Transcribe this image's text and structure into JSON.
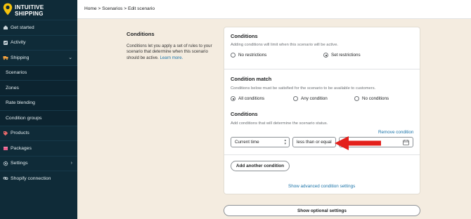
{
  "brand": {
    "line1": "INTUITIVE",
    "line2": "SHIPPING"
  },
  "sidebar": {
    "items": [
      {
        "label": "Get started",
        "icon": "home-icon"
      },
      {
        "label": "Activity",
        "icon": "activity-icon"
      },
      {
        "label": "Shipping",
        "icon": "truck-icon",
        "expanded": true
      },
      {
        "label": "Scenarios",
        "sub": true
      },
      {
        "label": "Zones",
        "sub": true
      },
      {
        "label": "Rate blending",
        "sub": true
      },
      {
        "label": "Condition groups",
        "sub": true
      },
      {
        "label": "Products",
        "icon": "tag-icon"
      },
      {
        "label": "Packages",
        "icon": "package-icon"
      },
      {
        "label": "Settings",
        "icon": "gear-icon"
      },
      {
        "label": "Shopify connection",
        "icon": "link-icon"
      }
    ]
  },
  "breadcrumb": "Home > Scenarios > Edit scenario",
  "description": {
    "title": "Conditions",
    "text": "Conditions let you apply a set of rules to your scenario that determine when this scenario should be active.",
    "link": "Learn more."
  },
  "conditions_card": {
    "title": "Conditions",
    "help": "Adding conditions will limit when this scenario will be active.",
    "options": [
      "No restrictions",
      "Set restrictions"
    ],
    "selected": "Set restrictions"
  },
  "condition_match": {
    "title": "Condition match",
    "help": "Conditions below must be satisfied for the scenario to be available to customers.",
    "options": [
      "All conditions",
      "Any condition",
      "No conditions"
    ],
    "selected": "All conditions"
  },
  "conditions_list": {
    "title": "Conditions",
    "help": "Add conditions that will determine the scenario status.",
    "remove_label": "Remove condition",
    "field_value": "Current time",
    "operator_value": "less than or equal",
    "add_label": "Add another condition",
    "advanced_label": "Show advanced condition settings"
  },
  "optional_settings_label": "Show optional settings",
  "colors": {
    "sidebar": "#0f2b38",
    "link": "#1a73a8",
    "arrow": "#e3201b",
    "logo_pin": "#f4c20d",
    "page_bg": "#f4ece0"
  }
}
